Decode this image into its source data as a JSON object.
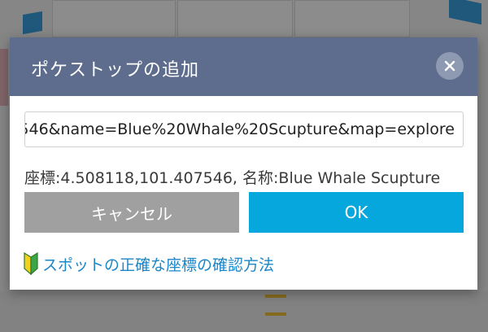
{
  "dialog": {
    "title": "ポケストップの追加",
    "url_value": "546&name=Blue%20Whale%20Scupture&map=explore",
    "coord_label": "座標:4.508118,101.407546, 名称:Blue Whale Scupture",
    "cancel_label": "キャンセル",
    "ok_label": "OK",
    "help_link": "スポットの正確な座標の確認方法"
  },
  "colors": {
    "header": "#5e6d8d",
    "ok": "#05a7dc",
    "cancel": "#a0a0a0",
    "link": "#1b86c8"
  },
  "icons": {
    "close": "close-icon",
    "help": "beginner-mark-icon"
  }
}
